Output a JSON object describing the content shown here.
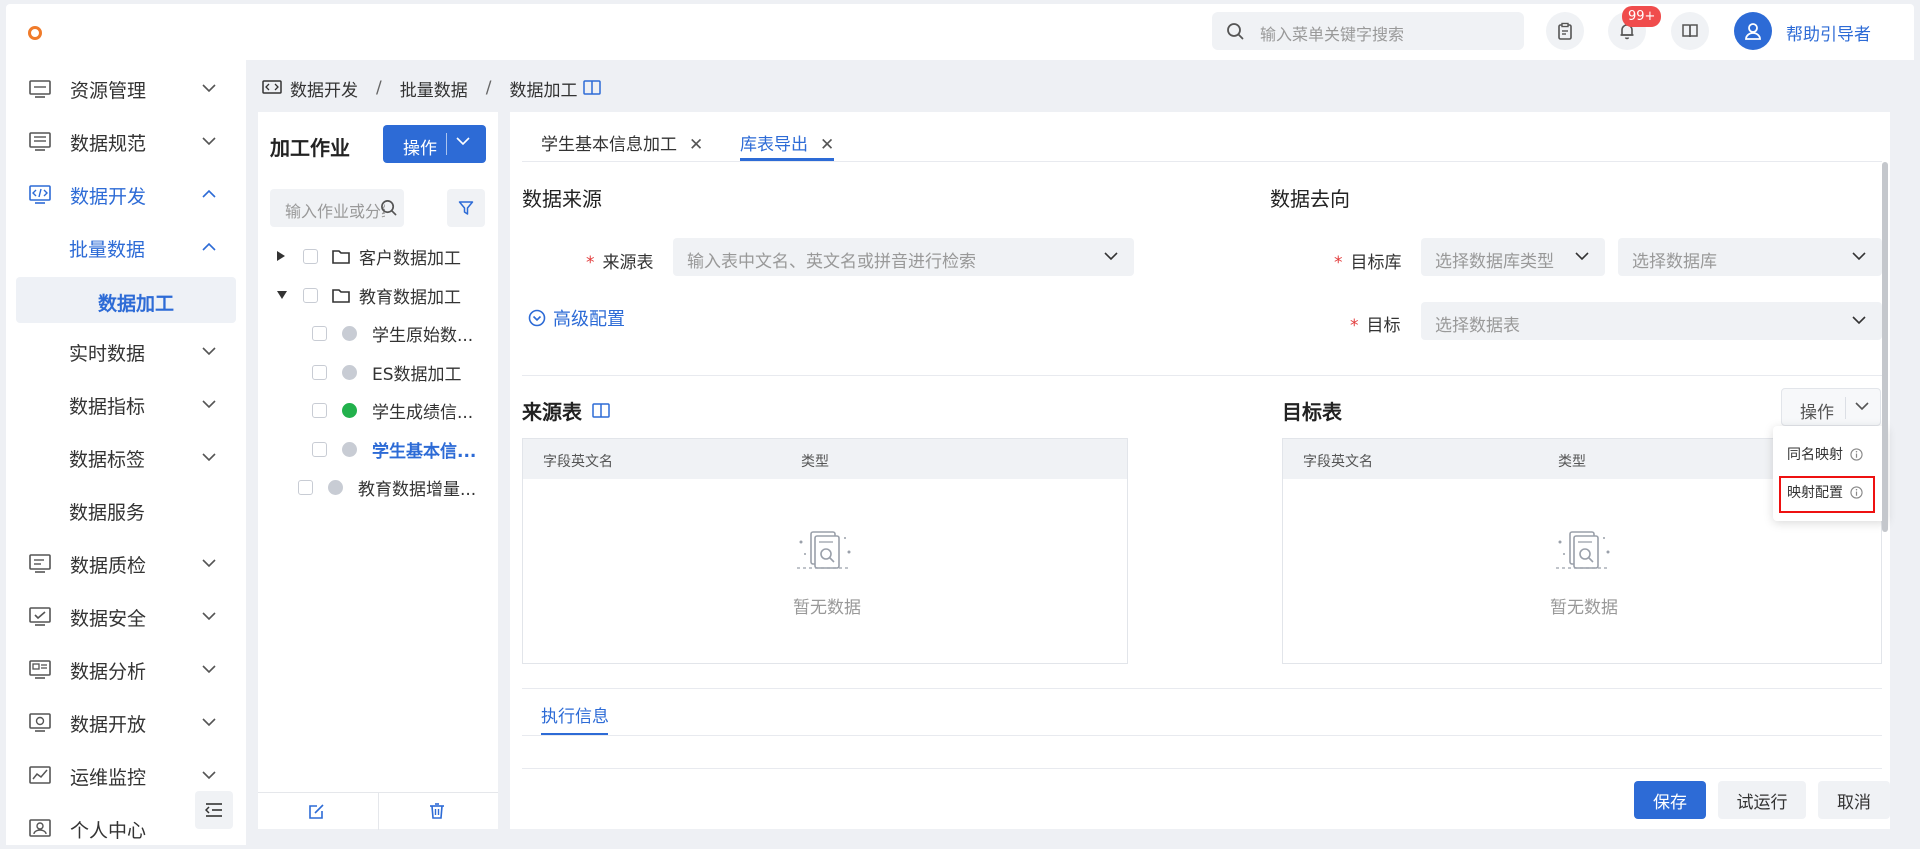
{
  "header": {
    "search_placeholder": "输入菜单关键字搜索",
    "notification_badge": "99+",
    "username": "帮助引导者"
  },
  "sidebar": {
    "items": [
      {
        "label": "资源管理",
        "icon": "server-icon"
      },
      {
        "label": "数据规范",
        "icon": "monitor-icon"
      },
      {
        "label": "数据开发",
        "icon": "code-icon"
      },
      {
        "label": "批量数据"
      },
      {
        "label": "数据加工"
      },
      {
        "label": "实时数据"
      },
      {
        "label": "数据指标"
      },
      {
        "label": "数据标签"
      },
      {
        "label": "数据服务"
      },
      {
        "label": "数据质检",
        "icon": "monitor-icon"
      },
      {
        "label": "数据安全",
        "icon": "check-screen-icon"
      },
      {
        "label": "数据分析",
        "icon": "analysis-icon"
      },
      {
        "label": "数据开放",
        "icon": "open-icon"
      },
      {
        "label": "运维监控",
        "icon": "chart-line-icon"
      },
      {
        "label": "个人中心",
        "icon": "user-card-icon"
      }
    ]
  },
  "breadcrumb": [
    "数据开发",
    "批量数据",
    "数据加工"
  ],
  "job_panel": {
    "title": "加工作业",
    "op_button": "操作",
    "search_placeholder": "输入作业或分组",
    "tree": [
      {
        "label": "客户数据加工",
        "type": "folder",
        "expanded": false
      },
      {
        "label": "教育数据加工",
        "type": "folder",
        "expanded": true
      },
      {
        "label": "学生原始数...",
        "status": "gray"
      },
      {
        "label": "ES数据加工",
        "status": "gray"
      },
      {
        "label": "学生成绩信...",
        "status": "green"
      },
      {
        "label": "学生基本信...",
        "status": "gray",
        "selected": true
      },
      {
        "label": "教育数据增量...",
        "status": "gray"
      }
    ]
  },
  "tabs": [
    {
      "label": "学生基本信息加工",
      "active": false
    },
    {
      "label": "库表导出",
      "active": true
    }
  ],
  "source": {
    "title": "数据来源",
    "table_label": "来源表",
    "table_placeholder": "输入表中文名、英文名或拼音进行检索",
    "advanced": "高级配置"
  },
  "dest": {
    "title": "数据去向",
    "db_label": "目标库",
    "db_type_placeholder": "选择数据库类型",
    "db_placeholder": "选择数据库",
    "target_label": "目标",
    "target_placeholder": "选择数据表"
  },
  "source_table": {
    "title": "来源表",
    "col1": "字段英文名",
    "col2": "类型",
    "empty": "暂无数据"
  },
  "target_table": {
    "title": "目标表",
    "op_button": "操作",
    "col1": "字段英文名",
    "col2": "类型",
    "empty": "暂无数据",
    "dropdown": [
      "同名映射",
      "映射配置"
    ]
  },
  "exec_tab": "执行信息",
  "footer": {
    "save": "保存",
    "trial": "试运行",
    "cancel": "取消"
  },
  "colors": {
    "primary": "#2d6bd6",
    "danger": "#e11111",
    "success": "#22b14c"
  }
}
